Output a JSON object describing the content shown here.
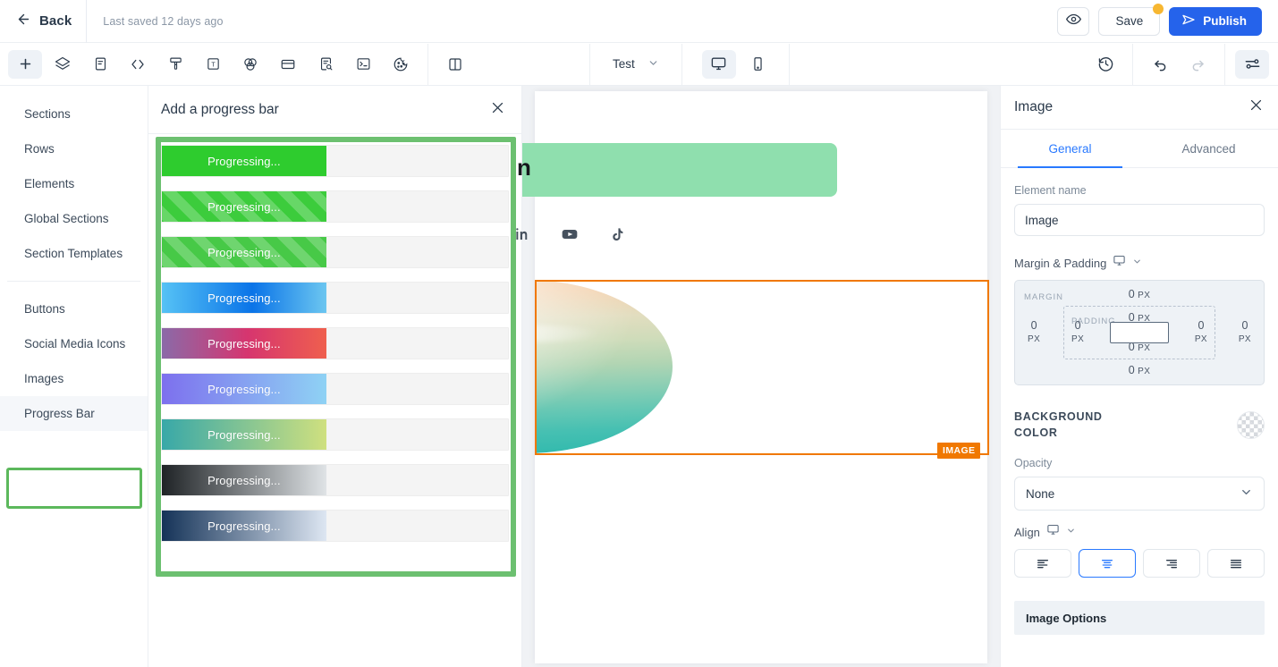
{
  "topbar": {
    "back_label": "Back",
    "last_saved": "Last saved 12 days ago",
    "preview_icon": "eye-icon",
    "save_label": "Save",
    "publish_label": "Publish",
    "publish_icon": "send-icon",
    "accent_color": "#2563eb",
    "save_dot_color": "#f7b731"
  },
  "toolbar": {
    "tools": [
      {
        "name": "add-icon",
        "glyph": "+"
      },
      {
        "name": "layers-icon"
      },
      {
        "name": "document-icon"
      },
      {
        "name": "code-icon"
      },
      {
        "name": "brush-icon"
      },
      {
        "name": "text-icon"
      },
      {
        "name": "color-blend-icon"
      },
      {
        "name": "card-icon"
      },
      {
        "name": "form-search-icon"
      },
      {
        "name": "terminal-icon"
      },
      {
        "name": "cookie-icon"
      }
    ],
    "split_view_icon": "split-view-icon",
    "test_label": "Test",
    "desktop_icon": "desktop-icon",
    "mobile_icon": "mobile-icon",
    "history_icon": "history-icon",
    "undo_icon": "undo-icon",
    "redo_icon": "redo-icon",
    "settings_icon": "settings-sliders-icon"
  },
  "sidebar": {
    "group_one": [
      "Sections",
      "Rows",
      "Elements",
      "Global Sections",
      "Section Templates"
    ],
    "group_two": [
      "Buttons",
      "Social Media Icons",
      "Images",
      "Progress Bar"
    ],
    "selected": "Progress Bar",
    "highlight_color": "#5cb85c"
  },
  "progress_panel": {
    "title": "Add a progress bar",
    "close_icon": "close-icon",
    "highlight_color": "#6cc070",
    "bars": [
      {
        "label": "Progressing...",
        "style": "solid",
        "fill": "linear-gradient(90deg,#2ecc2e,#2ecc2e)"
      },
      {
        "label": "Progressing...",
        "style": "striped",
        "fill": "linear-gradient(90deg,#3ccc3c,#3ccc3c)"
      },
      {
        "label": "Progressing...",
        "style": "striped",
        "fill": "linear-gradient(90deg,#4ecb4e,#41c741)"
      },
      {
        "label": "Progressing...",
        "style": "solid",
        "fill": "linear-gradient(90deg,#56c2f5,#0a74e8 55%,#6cc6f0)"
      },
      {
        "label": "Progressing...",
        "style": "solid",
        "fill": "linear-gradient(90deg,#8b6aa8,#d6356f 52%,#ef5f4e)"
      },
      {
        "label": "Progressing...",
        "style": "solid",
        "fill": "linear-gradient(90deg,#7d70ee,#8fd2f4)"
      },
      {
        "label": "Progressing...",
        "style": "solid",
        "fill": "linear-gradient(90deg,#38a8a8,#cfe07f)"
      },
      {
        "label": "Progressing...",
        "style": "solid",
        "fill": "linear-gradient(90deg,#1f2326,#dfe3e6)"
      },
      {
        "label": "Progressing...",
        "style": "solid",
        "fill": "linear-gradient(90deg,#153358,#dde6f2)"
      }
    ]
  },
  "canvas": {
    "banner_text": "n",
    "banner_color": "#8fdfae",
    "social_icons": [
      "linkedin-icon",
      "youtube-icon",
      "tiktok-icon"
    ],
    "image_badge": "IMAGE",
    "selection_color": "#f07800"
  },
  "right_panel": {
    "title": "Image",
    "close_icon": "close-icon",
    "tabs": [
      {
        "label": "General",
        "active": true
      },
      {
        "label": "Advanced",
        "active": false
      }
    ],
    "element_name_label": "Element name",
    "element_name_value": "Image",
    "margin_padding_label": "Margin & Padding",
    "margin_padding_device_icon": "desktop-icon",
    "margin_tag": "MARGIN",
    "padding_tag": "PADDING",
    "unit": "PX",
    "margin": {
      "top": "0",
      "right": "0",
      "bottom": "0",
      "left": "0"
    },
    "padding": {
      "top": "0",
      "right": "0",
      "bottom": "0",
      "left": "0"
    },
    "background_color_label_line1": "BACKGROUND",
    "background_color_label_line2": "COLOR",
    "background_swatch": "transparent-checker",
    "opacity_label": "Opacity",
    "opacity_value": "None",
    "align_label": "Align",
    "align_device_icon": "desktop-icon",
    "align_options": [
      {
        "name": "align-left",
        "active": false
      },
      {
        "name": "align-center",
        "active": true
      },
      {
        "name": "align-right",
        "active": false
      },
      {
        "name": "align-justify",
        "active": false
      }
    ],
    "image_options_label": "Image Options",
    "accent_color": "#2979ff"
  }
}
